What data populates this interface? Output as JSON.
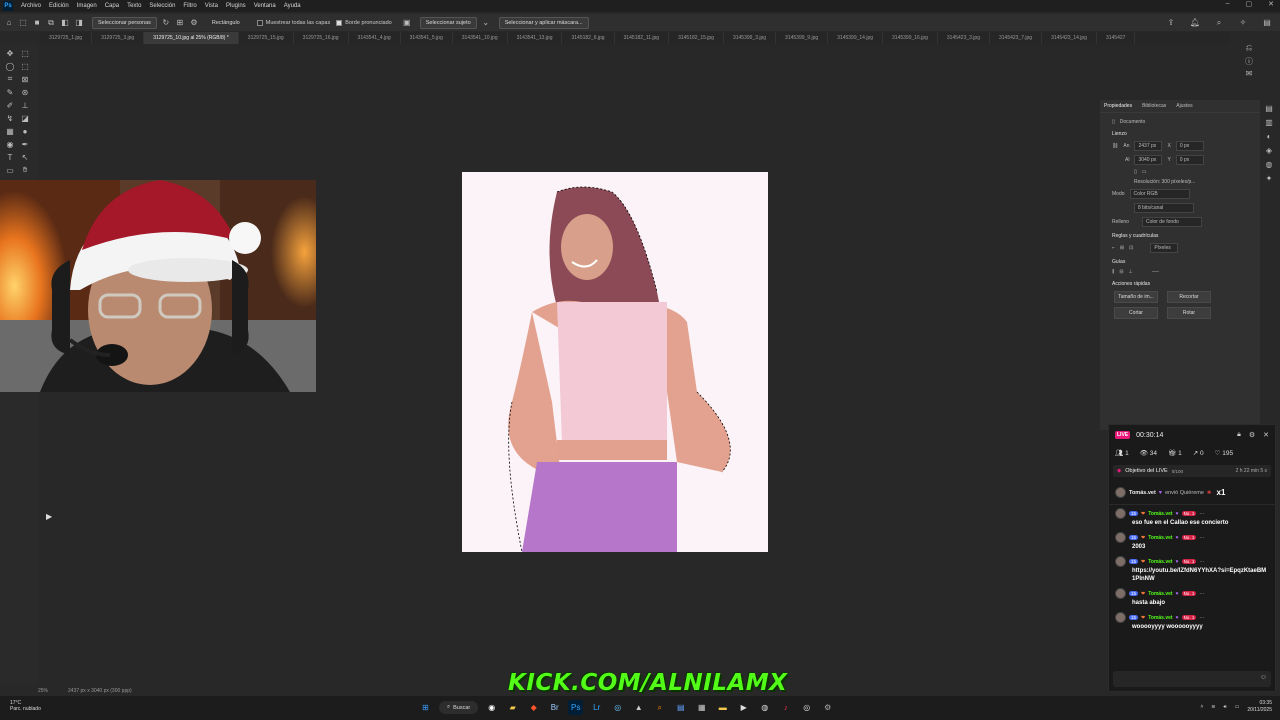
{
  "menubar": {
    "logo": "Ps",
    "items": [
      "Archivo",
      "Edición",
      "Imagen",
      "Capa",
      "Texto",
      "Selección",
      "Filtro",
      "Vista",
      "Plugins",
      "Ventana",
      "Ayuda"
    ],
    "controls": [
      "–",
      "▢",
      "✕"
    ]
  },
  "optionsbar": {
    "select_subject_mode": "Seleccionar personas",
    "shape": "Rectángulo",
    "sample_all_layers": "Muestrear todas las capas",
    "strong_edge": "Borde pronunciado",
    "select_subject": "Seleccionar sujeto",
    "select_and_mask": "Seleccionar y aplicar máscara..."
  },
  "tabs": [
    "3129725_1.jpg",
    "3129725_3.jpg",
    "3129725_10.jpg al 25% (RGB/8) *",
    "3129725_15.jpg",
    "3129725_16.jpg",
    "3143541_4.jpg",
    "3143541_5.jpg",
    "3143541_10.jpg",
    "3143541_13.jpg",
    "3145182_6.jpg",
    "3145182_11.jpg",
    "3145182_15.jpg",
    "3145399_3.jpg",
    "3145399_9.jpg",
    "3145399_14.jpg",
    "3145399_16.jpg",
    "3145423_3.jpg",
    "3145423_7.jpg",
    "3145423_14.jpg",
    "3145427"
  ],
  "properties": {
    "tabs": [
      "Propiedades",
      "Bibliotecas",
      "Ajustes"
    ],
    "doc_label": "Documento",
    "canvas_section": "Lienzo",
    "w_label": "An",
    "w_value": "2437 px",
    "h_label": "Al",
    "h_value": "3040 px",
    "x_label": "X",
    "x_value": "0 px",
    "y_label": "Y",
    "y_value": "0 px",
    "resolution": "Resolución: 300 píxeles/p...",
    "mode_label": "Modo",
    "mode_value": "Color RGB",
    "bits_value": "8 bits/canal",
    "fill_label": "Relleno",
    "fill_value": "Color de fondo",
    "rulers_section": "Reglas y cuadrículas",
    "units_value": "Píxeles",
    "guides_section": "Guías",
    "quick_section": "Acciones rápidas",
    "btn_image_size": "Tamaño de im...",
    "btn_crop": "Recortar",
    "btn_trim": "Cortar",
    "btn_rotate": "Rotar"
  },
  "status": {
    "zoom": "25%",
    "doc_size": "2437 px x 3040 px (300 ppp)"
  },
  "banner": "KICK.COM/ALNILAMX",
  "chat": {
    "live_badge": "LIVE",
    "timer": "00:30:14",
    "stats": {
      "users": "1",
      "views": "34",
      "gifts": "1",
      "shares": "0",
      "likes": "195"
    },
    "goal_label": "Objetivo del LIVE",
    "goal_progress": "0/100",
    "goal_time": "2 h 22 min 5 s",
    "gift": {
      "user": "Tomás.vet",
      "action": "envió Quiéreme",
      "multiplier": "x1"
    },
    "messages": [
      {
        "level": "15",
        "user": "Tomás.vet",
        "rank": "No. 1",
        "text": "eso fue en el Callao ese concierto"
      },
      {
        "level": "15",
        "user": "Tomás.vet",
        "rank": "No. 1",
        "text": "2003"
      },
      {
        "level": "15",
        "user": "Tomás.vet",
        "rank": "No. 1",
        "text": "https://youtu.be/lZfdN6YYhXA?si=EpqzKtaeBM1PlnNW"
      },
      {
        "level": "15",
        "user": "Tomás.vet",
        "rank": "No. 1",
        "text": "hasta abajo"
      },
      {
        "level": "15",
        "user": "Tomás.vet",
        "rank": "No. 1",
        "text": "wooooyyyy woooooyyyy"
      }
    ]
  },
  "taskbar": {
    "temp": "17°C",
    "weather": "Parc. nublado",
    "search_label": "Buscar",
    "time": "03:35",
    "date": "20/11/2025"
  },
  "colors": {
    "kick_green": "#53fc18",
    "live_pink": "#e9197c",
    "ps_blue": "#31a8ff"
  }
}
